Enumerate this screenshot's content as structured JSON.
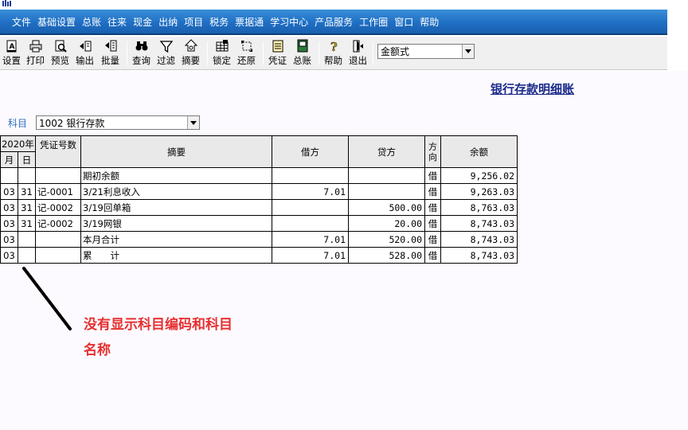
{
  "menu": [
    "文件",
    "基础设置",
    "总账",
    "往来",
    "现金",
    "出纳",
    "项目",
    "税务",
    "票据通",
    "学习中心",
    "产品服务",
    "工作圈",
    "窗口",
    "帮助"
  ],
  "toolbar": {
    "buttons": [
      {
        "label": "设置",
        "icon": "settings-icon"
      },
      {
        "label": "打印",
        "icon": "printer-icon"
      },
      {
        "label": "预览",
        "icon": "preview-icon"
      },
      {
        "label": "输出",
        "icon": "export-icon"
      },
      {
        "label": "批量",
        "icon": "batch-icon"
      },
      {
        "label": "查询",
        "icon": "binoculars-icon"
      },
      {
        "label": "过滤",
        "icon": "filter-icon"
      },
      {
        "label": "摘要",
        "icon": "summary-icon"
      },
      {
        "label": "锁定",
        "icon": "lock-icon"
      },
      {
        "label": "还原",
        "icon": "restore-icon"
      },
      {
        "label": "凭证",
        "icon": "voucher-icon"
      },
      {
        "label": "总账",
        "icon": "ledger-icon"
      },
      {
        "label": "帮助",
        "icon": "help-icon"
      },
      {
        "label": "退出",
        "icon": "exit-icon"
      }
    ],
    "format_select": "金额式"
  },
  "report": {
    "title": "银行存款明细账",
    "subject_label": "科目",
    "subject_value": "1002 银行存款"
  },
  "table": {
    "year_header": "2020年",
    "month_header": "月",
    "day_header": "日",
    "voucher_header": "凭证号数",
    "summary_header": "摘要",
    "debit_header": "借方",
    "credit_header": "贷方",
    "direction_header": "方向",
    "balance_header": "余额",
    "rows": [
      {
        "month": "",
        "day": "",
        "voucher": "",
        "summary": "期初余额",
        "debit": "",
        "credit": "",
        "direction": "借",
        "balance": "9,256.02"
      },
      {
        "month": "03",
        "day": "31",
        "voucher": "记-0001",
        "summary": "3/21利息收入",
        "debit": "7.01",
        "credit": "",
        "direction": "借",
        "balance": "9,263.03"
      },
      {
        "month": "03",
        "day": "31",
        "voucher": "记-0002",
        "summary": "3/19回单箱",
        "debit": "",
        "credit": "500.00",
        "direction": "借",
        "balance": "8,763.03"
      },
      {
        "month": "03",
        "day": "31",
        "voucher": "记-0002",
        "summary": "3/19网银",
        "debit": "",
        "credit": "20.00",
        "direction": "借",
        "balance": "8,743.03"
      },
      {
        "month": "03",
        "day": "",
        "voucher": "",
        "summary": "本月合计",
        "debit": "7.01",
        "credit": "520.00",
        "direction": "借",
        "balance": "8,743.03"
      },
      {
        "month": "03",
        "day": "",
        "voucher": "",
        "summary": "累　　计",
        "debit": "7.01",
        "credit": "528.00",
        "direction": "借",
        "balance": "8,743.03"
      }
    ]
  },
  "annotation": {
    "line1": "没有显示科目编码和科目",
    "line2": "名称",
    "color": "#e53030"
  },
  "colors": {
    "menubar": "#1f6fc4",
    "title": "#1a2a8a",
    "subject_label": "#2f6fbf"
  }
}
